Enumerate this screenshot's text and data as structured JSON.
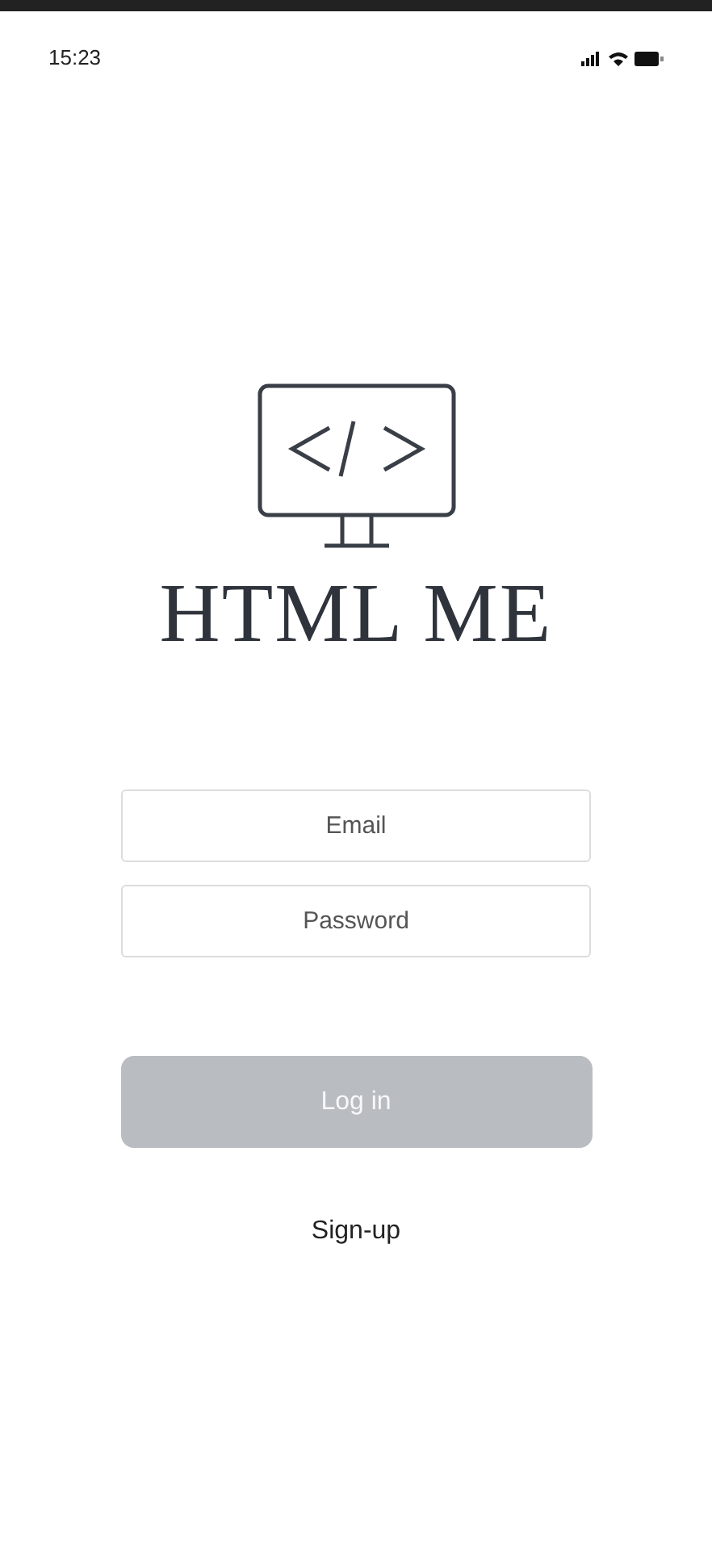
{
  "status_bar": {
    "time": "15:23"
  },
  "app": {
    "title": "HTML ME"
  },
  "fields": [
    {
      "placeholder": "Email"
    },
    {
      "placeholder": "Password"
    }
  ],
  "login_button": {
    "label": "Log in",
    "disabled": true
  },
  "signup_link": {
    "label": "Sign-up"
  }
}
